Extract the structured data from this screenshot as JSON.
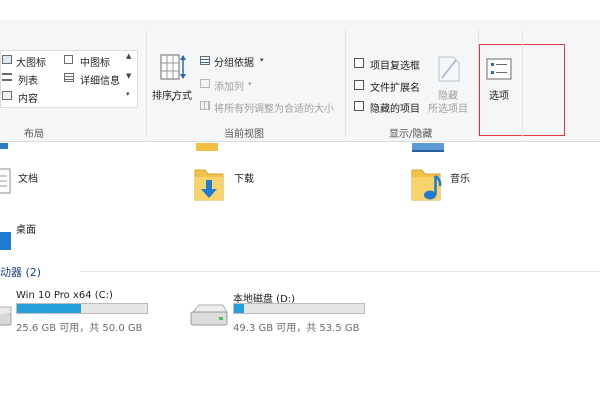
{
  "ribbon": {
    "layout_group": {
      "label": "布局",
      "items": [
        "大图标",
        "中图标",
        "列表",
        "详细信息",
        "内容"
      ]
    },
    "current_view_group": {
      "label": "当前视图",
      "sort_label": "排序方式",
      "group_by_label": "分组依据",
      "add_columns_label": "添加列",
      "fit_columns_label": "将所有列调整为合适的大小"
    },
    "show_hide_group": {
      "label": "显示/隐藏",
      "item_checkboxes": "项目复选框",
      "file_extensions": "文件扩展名",
      "hidden_items": "隐藏的项目",
      "hide_selected_line1": "隐藏",
      "hide_selected_line2": "所选项目"
    },
    "options_label": "选项"
  },
  "folders": [
    {
      "name": "文档",
      "icon": "document-icon"
    },
    {
      "name": "下载",
      "icon": "download-folder-icon"
    },
    {
      "name": "音乐",
      "icon": "music-folder-icon"
    },
    {
      "name": "桌面",
      "icon": "desktop-icon"
    }
  ],
  "devices": {
    "heading": "动器 (2)",
    "drives": [
      {
        "name": "Win 10 Pro x64 (C:)",
        "info": "25.6 GB 可用，共 50.0 GB",
        "used_fraction": 0.49
      },
      {
        "name": "本地磁盘 (D:)",
        "info": "49.3 GB 可用，共 53.5 GB",
        "used_fraction": 0.08
      }
    ]
  },
  "colors": {
    "accent": "#26a0da",
    "highlight_box": "#e03b3b",
    "section_heading": "#1e3f8c"
  }
}
